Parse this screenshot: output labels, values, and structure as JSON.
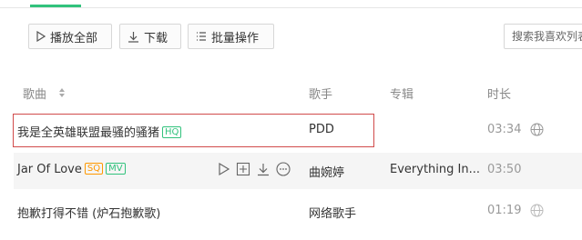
{
  "toolbar": {
    "play_all_label": "播放全部",
    "download_label": "下载",
    "batch_label": "批量操作"
  },
  "search": {
    "placeholder": "搜索我喜欢列表"
  },
  "columns": {
    "song": "歌曲",
    "singer": "歌手",
    "album": "专辑",
    "duration": "时长"
  },
  "songs": [
    {
      "title": "我是全英雄联盟最骚的骚猪",
      "badges": [
        "HQ"
      ],
      "singer": "PDD",
      "album": "",
      "duration": "03:34"
    },
    {
      "title": "Jar Of Love",
      "badges": [
        "SQ",
        "MV"
      ],
      "singer": "曲婉婷",
      "album": "Everything In...",
      "duration": "03:50"
    },
    {
      "title": "抱歉打得不错 (炉石抱歉歌)",
      "badges": [],
      "singer": "网络歌手",
      "album": "",
      "duration": "01:19"
    }
  ],
  "colors": {
    "accent": "#31c27c",
    "highlight": "#d14b4b",
    "sq_badge": "#ff9800"
  }
}
